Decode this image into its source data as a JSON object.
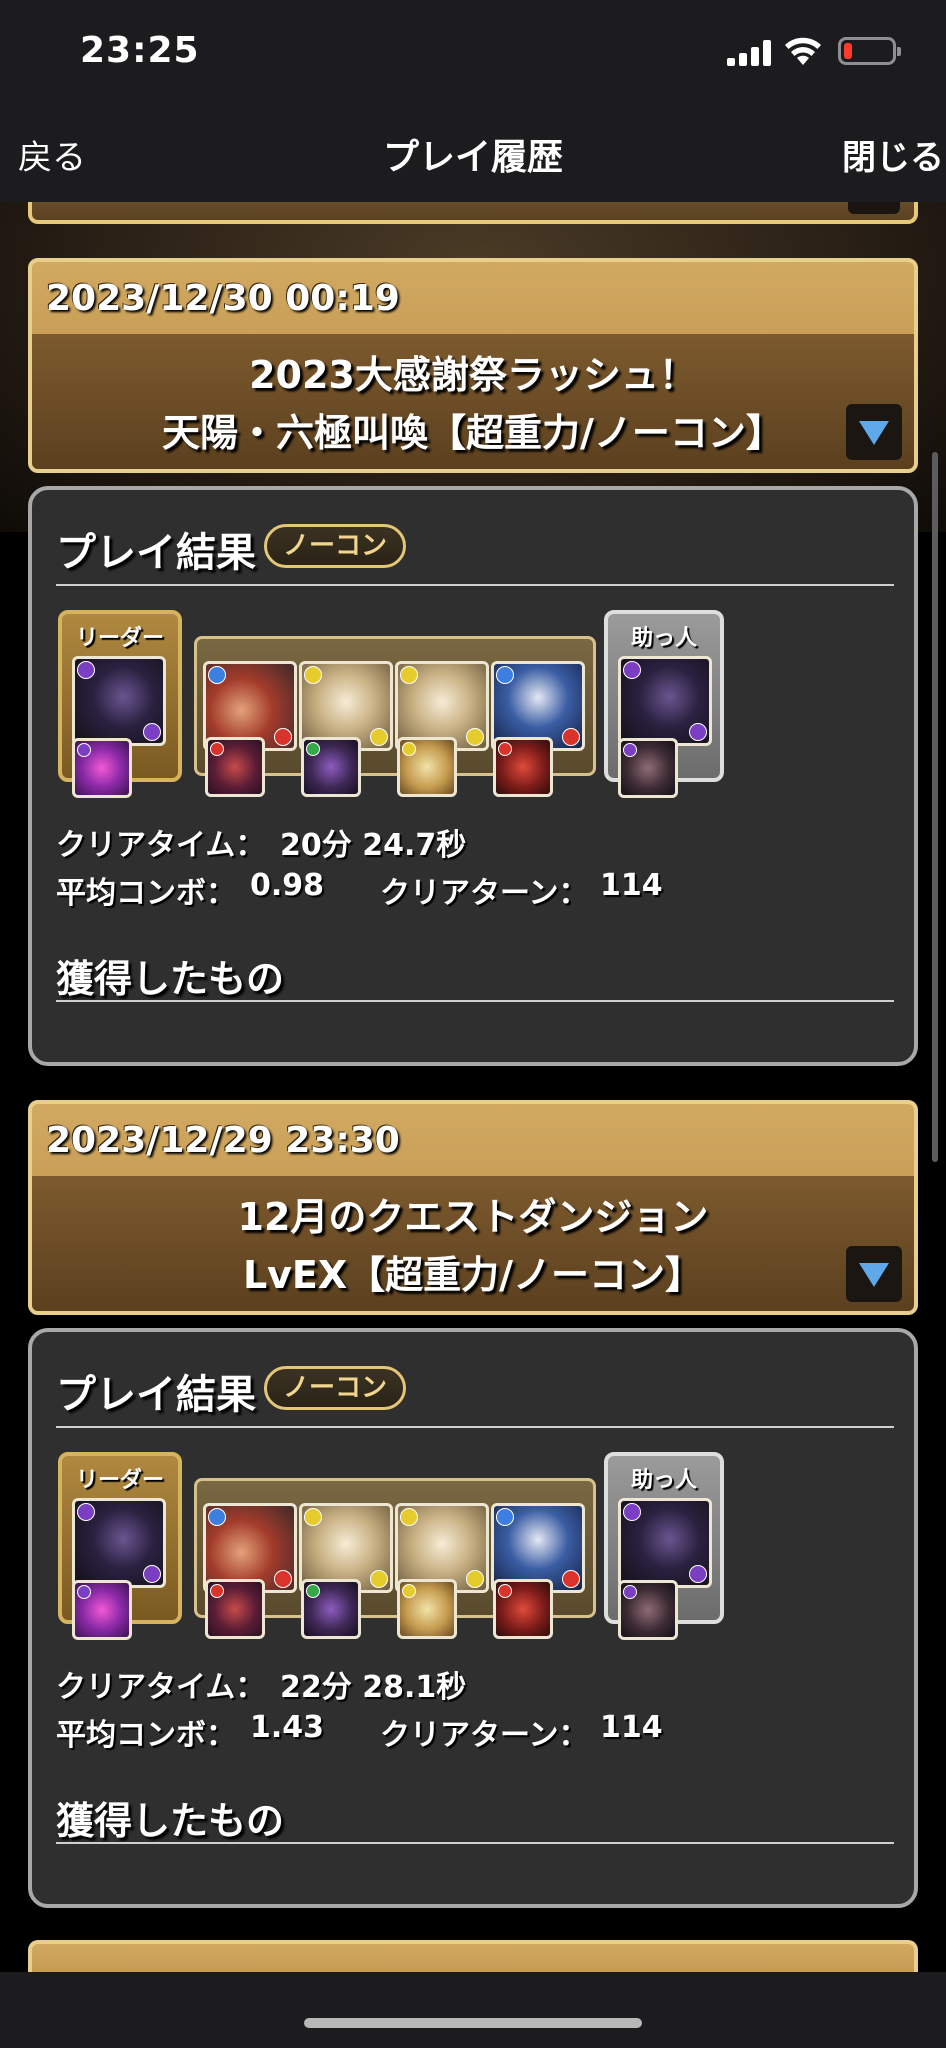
{
  "status_bar": {
    "time": "23:25",
    "battery_color": "#ff3b30"
  },
  "nav": {
    "back_label": "戻る",
    "title": "プレイ履歴",
    "close_label": "閉じる"
  },
  "entries": [
    {
      "date": "2023/12/30 00:19",
      "quest_line1": "2023大感謝祭ラッシュ！",
      "quest_line2": "天陽・六極叫喚【超重力/ノーコン】",
      "result_title": "プレイ結果",
      "badge": "ノーコン",
      "leader_label": "リーダー",
      "helper_label": "助っ人",
      "clear_time_label": "クリアタイム：",
      "clear_time": "20分 24.7秒",
      "avg_combo_label": "平均コンボ：",
      "avg_combo": "0.98",
      "clear_turn_label": "クリアターン：",
      "clear_turn": "114",
      "earned_label": "獲得したもの"
    },
    {
      "date": "2023/12/29 23:30",
      "quest_line1": "12月のクエストダンジョン",
      "quest_line2": "LvEX【超重力/ノーコン】",
      "result_title": "プレイ結果",
      "badge": "ノーコン",
      "leader_label": "リーダー",
      "helper_label": "助っ人",
      "clear_time_label": "クリアタイム：",
      "clear_time": "22分 28.1秒",
      "avg_combo_label": "平均コンボ：",
      "avg_combo": "1.43",
      "clear_turn_label": "クリアターン：",
      "clear_turn": "114",
      "earned_label": "獲得したもの"
    }
  ],
  "team_icons": {
    "leader": "dark-dragon-monster-icon",
    "subs": [
      "water-fire-pirate-monster-icon",
      "light-goddess-monster-icon",
      "light-goddess-monster-icon",
      "water-robot-monster-icon"
    ],
    "helper": "dark-dragon-monster-icon"
  },
  "colors": {
    "gold_border": "#e8cf8c",
    "panel_bg": "#2f2f2f",
    "accent_blue": "#5fa8ea"
  }
}
